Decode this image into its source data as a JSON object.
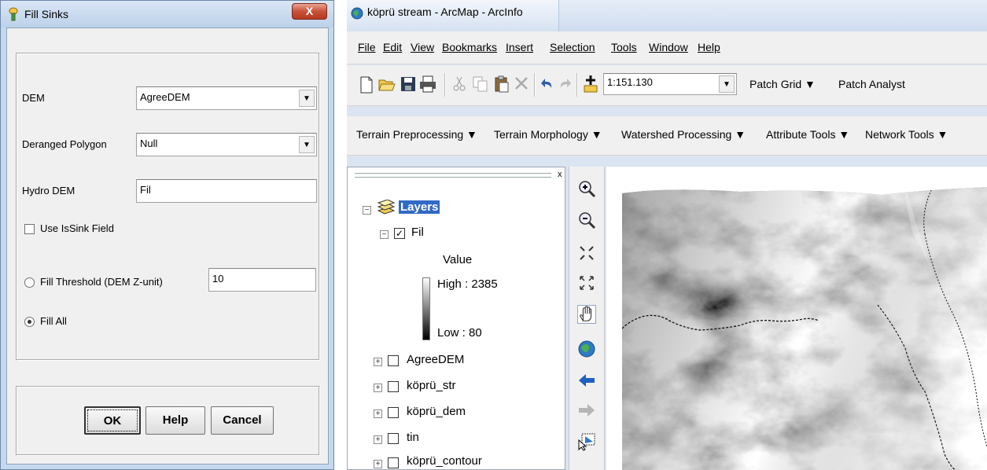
{
  "fill_sinks": {
    "title": "Fill Sinks",
    "close_label": "X",
    "dem_label": "DEM",
    "dem_value": "AgreeDEM",
    "deranged_label": "Deranged Polygon",
    "deranged_value": "Null",
    "hydro_label": "Hydro DEM",
    "hydro_value": "Fil",
    "use_issink_label": "Use IsSink Field",
    "use_issink_checked": false,
    "threshold_label": "Fill Threshold (DEM Z-unit)",
    "threshold_value": "10",
    "fill_all_label": "Fill All",
    "selected_option": "Fill All",
    "ok_label": "OK",
    "help_label": "Help",
    "cancel_label": "Cancel"
  },
  "arcmap": {
    "title": "köprü stream - ArcMap - ArcInfo",
    "menus": [
      "File",
      "Edit",
      "View",
      "Bookmarks",
      "Insert",
      "Selection",
      "Tools",
      "Window",
      "Help"
    ],
    "scale_value": "1:151.130",
    "patch_grid": "Patch Grid ▼",
    "patch_analyst": "Patch Analyst",
    "arc_hydro_toolbar": [
      "Terrain Preprocessing ▼",
      "Terrain Morphology ▼",
      "Watershed Processing ▼",
      "Attribute Tools ▼",
      "Network Tools ▼"
    ],
    "toc": {
      "close": "x",
      "root": "Layers",
      "layer_fil": "Fil",
      "layer_fil_checked": true,
      "legend_title": "Value",
      "legend_high": "High : 2385",
      "legend_low": "Low : 80",
      "layers": [
        "AgreeDEM",
        "köprü_str",
        "köprü_dem",
        "tin",
        "köprü_contour"
      ]
    },
    "colors": {
      "layers_highlight": "#3169c6",
      "toolbar_bg": "#f0f0f0"
    }
  }
}
